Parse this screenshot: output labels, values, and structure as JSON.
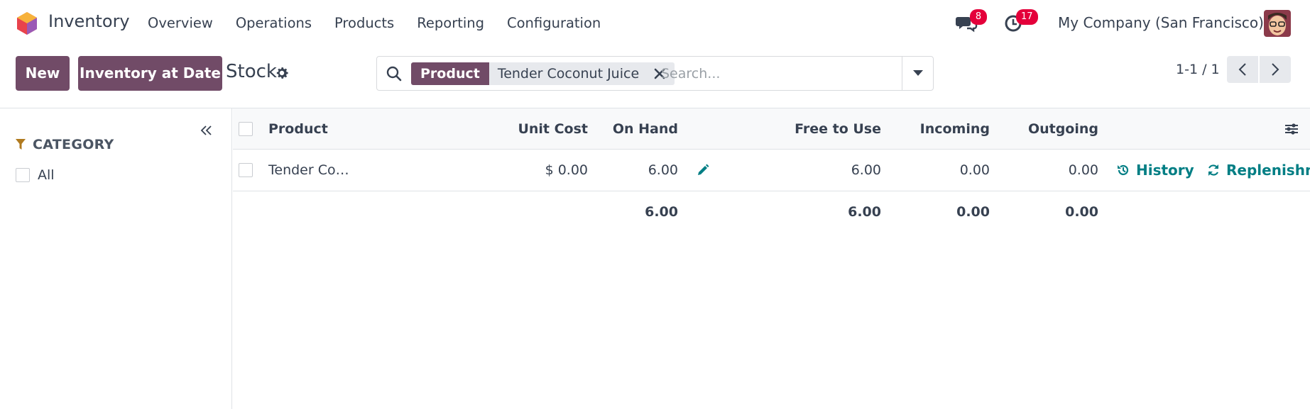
{
  "navbar": {
    "app_name": "Inventory",
    "menu": [
      "Overview",
      "Operations",
      "Products",
      "Reporting",
      "Configuration"
    ],
    "messages_badge": "8",
    "activities_badge": "17",
    "company": "My Company (San Francisco)"
  },
  "control_panel": {
    "new_label": "New",
    "inventory_at_date_label": "Inventory at Date",
    "title": "Stock",
    "search": {
      "facet_label": "Product",
      "facet_value": "Tender Coconut Juice",
      "placeholder": "Search..."
    },
    "pager": "1-1 / 1"
  },
  "sidebar": {
    "category_heading": "CATEGORY",
    "items": [
      "All"
    ]
  },
  "table": {
    "columns": [
      "Product",
      "Unit Cost",
      "On Hand",
      "Free to Use",
      "Incoming",
      "Outgoing"
    ],
    "rows": [
      {
        "product": "Tender Co…",
        "unit_cost": "$ 0.00",
        "on_hand": "6.00",
        "free_to_use": "6.00",
        "incoming": "0.00",
        "outgoing": "0.00",
        "history_label": "History",
        "replenish_label": "Replenishm"
      }
    ],
    "totals": {
      "on_hand": "6.00",
      "free_to_use": "6.00",
      "incoming": "0.00",
      "outgoing": "0.00"
    }
  },
  "colors": {
    "primary": "#714b67",
    "action": "#017e84",
    "badge": "#e4003a"
  }
}
